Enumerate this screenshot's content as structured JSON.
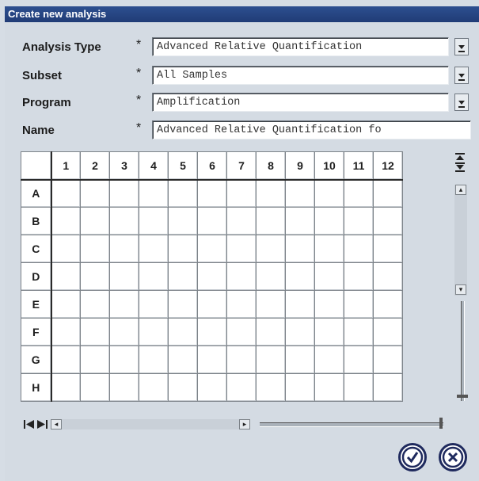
{
  "window": {
    "title": "Create new analysis"
  },
  "form": {
    "analysis_type": {
      "label": "Analysis Type",
      "value": "Advanced Relative Quantification"
    },
    "subset": {
      "label": "Subset",
      "value": "All Samples"
    },
    "program": {
      "label": "Program",
      "value": "Amplification"
    },
    "name": {
      "label": "Name",
      "value": "Advanced Relative Quantification fo"
    },
    "required_marker": "*"
  },
  "plate": {
    "columns": [
      "1",
      "2",
      "3",
      "4",
      "5",
      "6",
      "7",
      "8",
      "9",
      "10",
      "11",
      "12"
    ],
    "rows": [
      "A",
      "B",
      "C",
      "D",
      "E",
      "F",
      "G",
      "H"
    ]
  },
  "buttons": {
    "ok": "ok-icon",
    "cancel": "cancel-icon"
  }
}
